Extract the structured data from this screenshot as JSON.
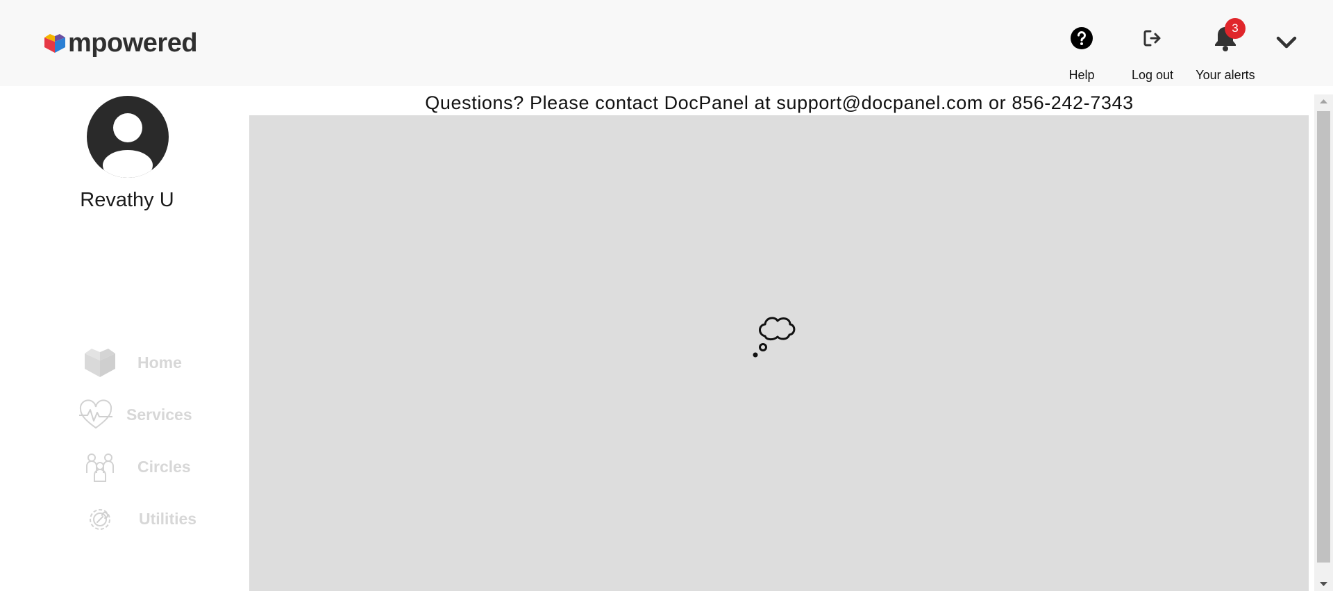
{
  "brand": {
    "name": "mpowered"
  },
  "header": {
    "help_label": "Help",
    "logout_label": "Log out",
    "alerts_label": "Your alerts",
    "alerts_count": "3"
  },
  "sidebar": {
    "user_name": "Revathy U",
    "nav": [
      {
        "label": "Home",
        "icon": "home-heart-icon"
      },
      {
        "label": "Services",
        "icon": "heart-pulse-icon"
      },
      {
        "label": "Circles",
        "icon": "people-group-icon"
      },
      {
        "label": "Utilities",
        "icon": "gear-wrench-icon"
      }
    ]
  },
  "main": {
    "contact_text": "Questions? Please contact DocPanel at support@docpanel.com or 856-242-7343",
    "loading_icon": "thought-bubble-icon"
  },
  "colors": {
    "header_bg": "#f8f8f8",
    "panel_bg": "#dddddd",
    "badge": "#e0262b",
    "nav_disabled": "#d7d7d7",
    "logo_red": "#e63946",
    "logo_blue": "#2a7fd4",
    "logo_yellow": "#f4b400",
    "logo_purple": "#6b4fa0"
  }
}
